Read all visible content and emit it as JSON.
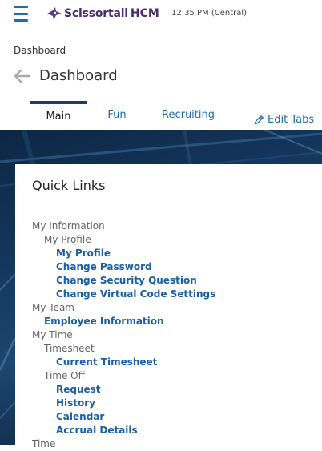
{
  "header": {
    "brand_name": "Scissortail",
    "brand_suffix": "HCM",
    "time": "12:35 PM (Central)"
  },
  "breadcrumb": "Dashboard",
  "page_title": "Dashboard",
  "tabs": [
    {
      "label": "Main",
      "active": true
    },
    {
      "label": "Fun",
      "active": false
    },
    {
      "label": "Recruiting",
      "active": false
    }
  ],
  "edit_tabs_label": "Edit Tabs",
  "quick_links": {
    "title": "Quick Links",
    "items": [
      {
        "label": "My Information",
        "level": 0,
        "link": false
      },
      {
        "label": "My Profile",
        "level": 1,
        "link": false
      },
      {
        "label": "My Profile",
        "level": 2,
        "link": true
      },
      {
        "label": "Change Password",
        "level": 2,
        "link": true
      },
      {
        "label": "Change Security Question",
        "level": 2,
        "link": true
      },
      {
        "label": "Change Virtual Code Settings",
        "level": 2,
        "link": true
      },
      {
        "label": "My Team",
        "level": 0,
        "link": false
      },
      {
        "label": "Employee Information",
        "level": 1,
        "link": true
      },
      {
        "label": "My Time",
        "level": 0,
        "link": false
      },
      {
        "label": "Timesheet",
        "level": 1,
        "link": false
      },
      {
        "label": "Current Timesheet",
        "level": 2,
        "link": true
      },
      {
        "label": "Time Off",
        "level": 1,
        "link": false
      },
      {
        "label": "Request",
        "level": 2,
        "link": true
      },
      {
        "label": "History",
        "level": 2,
        "link": true
      },
      {
        "label": "Calendar",
        "level": 2,
        "link": true
      },
      {
        "label": "Accrual Details",
        "level": 2,
        "link": true
      },
      {
        "label": "Time",
        "level": 0,
        "link": false
      }
    ]
  },
  "colors": {
    "accent": "#1a6db3",
    "link": "#1a5ea8",
    "brand": "#4a2d6e",
    "tab_active_border": "#1c3d6b"
  }
}
